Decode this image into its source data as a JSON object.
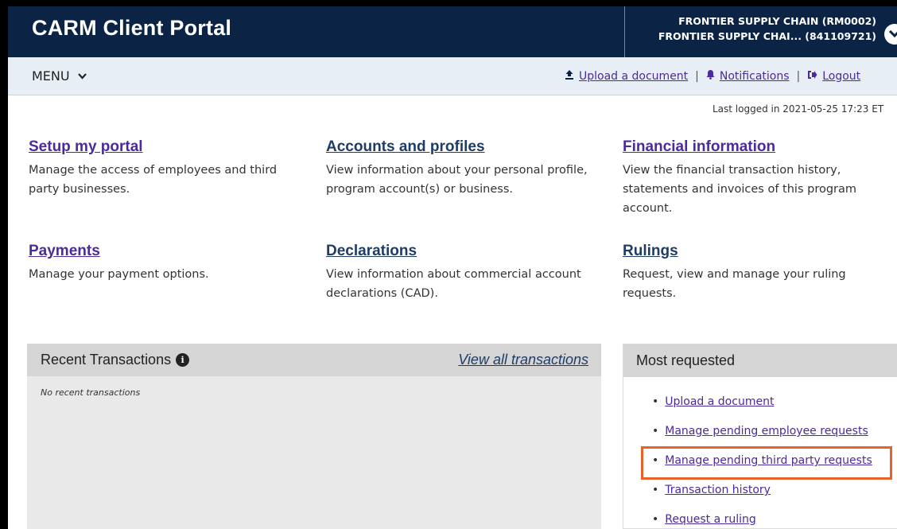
{
  "header": {
    "app_title": "CARM Client Portal",
    "account_line1": "FRONTIER SUPPLY CHAIN (RM0002)",
    "account_line2": "FRONTIER SUPPLY CHAI...  (841109721)"
  },
  "menubar": {
    "menu_label": "MENU",
    "upload_label": "Upload a document",
    "notifications_label": "Notifications",
    "logout_label": "Logout",
    "separator": "|"
  },
  "last_logged": "Last logged in 2021-05-25 17:23 ET",
  "cards": [
    {
      "title": "Setup my portal",
      "description": "Manage the access of employees and third party businesses."
    },
    {
      "title": "Accounts and profiles",
      "description": "View information about your personal profile, program account(s) or business."
    },
    {
      "title": "Financial information",
      "description": "View the financial transaction history, statements and invoices of this program account."
    },
    {
      "title": "Payments",
      "description": "Manage your payment options."
    },
    {
      "title": "Declarations",
      "description": "View information about commercial account declarations (CAD)."
    },
    {
      "title": "Rulings",
      "description": "Request, view and manage your ruling requests."
    }
  ],
  "recent": {
    "title": "Recent Transactions",
    "info_glyph": "i",
    "view_all": "View all transactions",
    "empty": "No recent transactions"
  },
  "most_requested": {
    "title": "Most requested",
    "bullet": "•",
    "items": [
      "Upload a document",
      "Manage pending employee requests",
      "Manage pending third party requests",
      "Transaction history",
      "Request a ruling"
    ]
  },
  "colors": {
    "header_bg": "#0b2446",
    "menubar_bg": "#e8eef6",
    "link": "#4b2a9c",
    "highlight": "#e5622a"
  }
}
